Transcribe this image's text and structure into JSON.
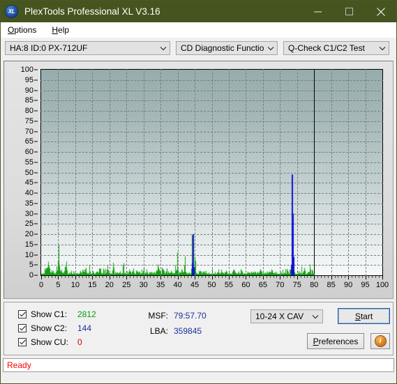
{
  "window": {
    "title": "PlexTools Professional XL V3.16",
    "icon": "XL",
    "minimize": "minimize-icon",
    "maximize": "maximize-icon",
    "close": "close-icon"
  },
  "menubar": {
    "items": [
      {
        "label": "Options",
        "accel": "O"
      },
      {
        "label": "Help",
        "accel": "H"
      }
    ]
  },
  "toolbar": {
    "drive_select": "HA:8 ID:0  PX-712UF",
    "function_select": "CD Diagnostic Functions",
    "test_select": "Q-Check C1/C2 Test"
  },
  "chart_data": {
    "type": "line",
    "title": "",
    "xlabel": "",
    "ylabel": "",
    "xlim": [
      0,
      100
    ],
    "ylim": [
      0,
      100
    ],
    "xticks": [
      0,
      5,
      10,
      15,
      20,
      25,
      30,
      35,
      40,
      45,
      50,
      55,
      60,
      65,
      70,
      75,
      80,
      85,
      90,
      95,
      100
    ],
    "yticks": [
      0,
      5,
      10,
      15,
      20,
      25,
      30,
      35,
      40,
      45,
      50,
      55,
      60,
      65,
      70,
      75,
      80,
      85,
      90,
      95,
      100
    ],
    "grid": true,
    "legend": "none",
    "data_end_x": 80,
    "colors": {
      "c1": "#14a014",
      "c2": "#0f0fd2",
      "cu": "#d00000"
    },
    "series": [
      {
        "name": "C1",
        "color": "#14a014",
        "x": [
          0.3,
          0.6,
          0.9,
          1.2,
          1.5,
          1.8,
          2.1,
          2.4,
          2.7,
          3.0,
          3.3,
          3.6,
          3.9,
          4.2,
          4.5,
          4.8,
          5.1,
          5.4,
          5.7,
          6.0,
          6.3,
          6.6,
          6.9,
          7.2,
          7.5,
          7.8,
          8.1,
          8.4,
          8.7,
          9.0,
          9.3,
          9.6,
          9.9,
          10.2,
          10.5,
          10.8,
          11.1,
          11.4,
          11.7,
          12.0,
          12.3,
          12.6,
          12.9,
          13.2,
          13.5,
          13.8,
          14.1,
          14.4,
          14.7,
          15.0,
          15.3,
          15.6,
          15.9,
          16.2,
          16.5,
          16.8,
          17.1,
          17.4,
          17.7,
          18.0,
          18.3,
          18.6,
          18.9,
          19.2,
          19.5,
          19.8,
          20.1,
          20.4,
          20.7,
          21.0,
          21.3,
          21.6,
          21.9,
          22.2,
          22.5,
          22.8,
          23.1,
          23.4,
          23.7,
          24.0,
          24.3,
          24.6,
          24.9,
          25.2,
          25.5,
          25.8,
          26.1,
          26.4,
          26.7,
          27.0,
          27.3,
          27.6,
          27.9,
          28.2,
          28.5,
          28.8,
          29.1,
          29.4,
          29.7,
          30.0,
          30.3,
          30.6,
          30.9,
          31.2,
          31.5,
          31.8,
          32.1,
          32.4,
          32.7,
          33.0,
          33.3,
          33.6,
          33.9,
          34.2,
          34.5,
          34.8,
          35.1,
          35.4,
          35.7,
          36.0,
          36.3,
          36.6,
          36.9,
          37.2,
          37.5,
          37.8,
          38.1,
          38.4,
          38.7,
          39.0,
          39.3,
          39.6,
          39.9,
          40.2,
          40.5,
          40.8,
          41.1,
          41.4,
          41.7,
          42.0,
          42.3,
          42.6,
          42.9,
          43.2,
          43.5,
          43.8,
          44.1,
          44.4,
          44.7,
          45.0,
          45.3,
          45.6,
          45.9,
          46.2,
          46.5,
          46.8,
          47.1,
          47.4,
          47.7,
          48.0,
          48.3,
          48.6,
          48.9,
          49.2,
          49.5,
          49.8,
          50.1,
          50.4,
          50.7,
          51.0,
          51.3,
          51.6,
          51.9,
          52.2,
          52.5,
          52.8,
          53.1,
          53.4,
          53.7,
          54.0,
          54.3,
          54.6,
          54.9,
          55.2,
          55.5,
          55.8,
          56.1,
          56.4,
          56.7,
          57.0,
          57.3,
          57.6,
          57.9,
          58.2,
          58.5,
          58.8,
          59.1,
          59.4,
          59.7,
          60.0,
          60.3,
          60.6,
          60.9,
          61.2,
          61.5,
          61.8,
          62.1,
          62.4,
          62.7,
          63.0,
          63.3,
          63.6,
          63.9,
          64.2,
          64.5,
          64.8,
          65.1,
          65.4,
          65.7,
          66.0,
          66.3,
          66.6,
          66.9,
          67.2,
          67.5,
          67.8,
          68.1,
          68.4,
          68.7,
          69.0,
          69.3,
          69.6,
          69.9,
          70.2,
          70.5,
          70.8,
          71.1,
          71.4,
          71.7,
          72.0,
          72.3,
          72.6,
          72.9,
          73.2,
          73.5,
          73.8,
          74.1,
          74.4,
          74.7,
          75.0,
          75.3,
          75.6,
          75.9,
          76.2,
          76.5,
          76.8,
          77.1,
          77.4,
          77.7,
          78.0,
          78.3,
          78.6,
          78.9,
          79.2,
          79.5,
          79.8
        ],
        "y": [
          0,
          1,
          3,
          4,
          5,
          2,
          16,
          5,
          3,
          2,
          4,
          2,
          5,
          1,
          3,
          2,
          15,
          4,
          2,
          3,
          1,
          2,
          4,
          11,
          3,
          2,
          1,
          2,
          4,
          2,
          1,
          3,
          2,
          1,
          2,
          1,
          1,
          2,
          3,
          2,
          5,
          1,
          3,
          4,
          2,
          1,
          5,
          2,
          3,
          2,
          2,
          1,
          1,
          2,
          3,
          2,
          8,
          3,
          2,
          1,
          11,
          3,
          2,
          10,
          3,
          2,
          1,
          2,
          1,
          16,
          4,
          2,
          3,
          1,
          2,
          1,
          2,
          1,
          2,
          10,
          3,
          2,
          1,
          2,
          1,
          3,
          2,
          1,
          2,
          4,
          2,
          1,
          3,
          2,
          1,
          2,
          1,
          3,
          2,
          4,
          2,
          1,
          3,
          2,
          1,
          2,
          1,
          2,
          4,
          2,
          1,
          3,
          2,
          6,
          3,
          2,
          1,
          8,
          3,
          2,
          1,
          2,
          4,
          2,
          1,
          3,
          2,
          1,
          2,
          1,
          4,
          2,
          12,
          4,
          2,
          1,
          3,
          2,
          1,
          13,
          4,
          2,
          1,
          2,
          1,
          3,
          24,
          5,
          2,
          9,
          3,
          2,
          1,
          2,
          3,
          2,
          1,
          2,
          1,
          3,
          2,
          1,
          2,
          1,
          2,
          1,
          3,
          2,
          1,
          2,
          1,
          2,
          3,
          2,
          1,
          2,
          1,
          2,
          1,
          3,
          2,
          1,
          2,
          1,
          2,
          1,
          2,
          3,
          2,
          1,
          2,
          1,
          2,
          1,
          3,
          2,
          1,
          2,
          1,
          2,
          1,
          2,
          1,
          3,
          2,
          1,
          2,
          1,
          2,
          1,
          2,
          1,
          2,
          3,
          2,
          1,
          2,
          1,
          2,
          1,
          2,
          1,
          2,
          1,
          3,
          2,
          1,
          2,
          1,
          2,
          1,
          2,
          1,
          2,
          1,
          3,
          2,
          1,
          5,
          3,
          2,
          1,
          6,
          3,
          2,
          1,
          2,
          1,
          2,
          1,
          2,
          3,
          2,
          5,
          2,
          1,
          3,
          2,
          1,
          2,
          1,
          7,
          3,
          2,
          5,
          3,
          2,
          1,
          4,
          2,
          1,
          2,
          1
        ]
      },
      {
        "name": "C2",
        "color": "#0f0fd2",
        "x": [
          44.4,
          73.5
        ],
        "y": [
          20,
          49
        ]
      },
      {
        "name": "CU",
        "color": "#d00000",
        "x": [],
        "y": []
      }
    ]
  },
  "controls": {
    "checkboxes": [
      {
        "label": "Show C1:",
        "value": "2812",
        "color": "#0a9e0a",
        "checked": true
      },
      {
        "label": "Show C2:",
        "value": "144",
        "color": "#1b2f9e",
        "checked": true
      },
      {
        "label": "Show CU:",
        "value": "0",
        "color": "#d00000",
        "checked": true
      }
    ],
    "msf_key": "MSF:",
    "msf_value": "79:57.70",
    "lba_key": "LBA:",
    "lba_value": "359845",
    "speed_select": "10-24 X CAV",
    "start_label": "Start",
    "start_accel": "S",
    "preferences_label": "Preferences",
    "preferences_accel": "P",
    "info_label": "i"
  },
  "statusbar": {
    "text": "Ready"
  }
}
